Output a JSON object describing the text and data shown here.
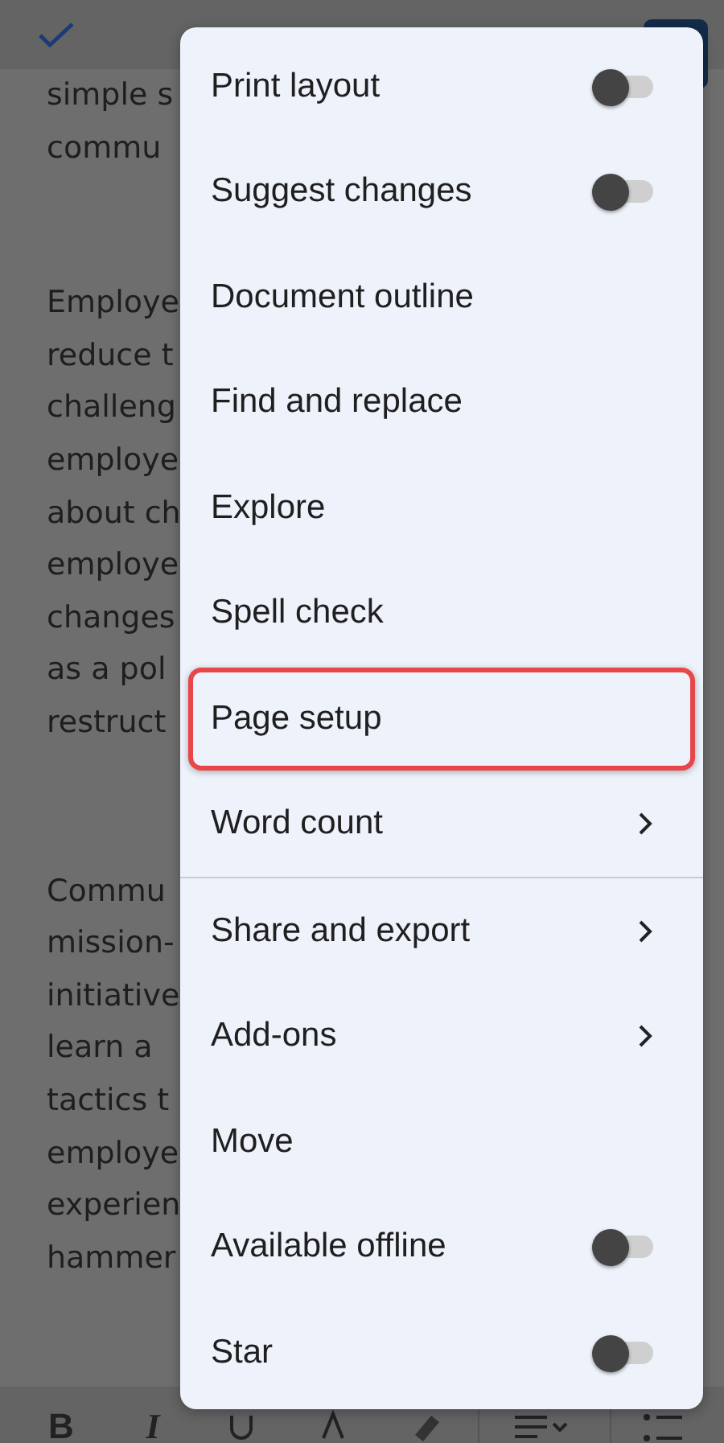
{
  "document": {
    "paragraphs": [
      {
        "lines": [
          "simple s",
          "commu"
        ]
      },
      {
        "lines": [
          "Employe",
          "reduce t",
          "challeng",
          "employe",
          "about ch",
          "employe",
          "changes",
          "as a pol",
          "restruct"
        ]
      },
      {
        "lines": [
          "Commu",
          "mission-",
          "initiative",
          "learn a",
          "tactics t",
          "employe",
          "experien",
          "hammer"
        ]
      }
    ]
  },
  "toolbar": {
    "bold": "B",
    "italic": "I"
  },
  "menu": {
    "sections": [
      {
        "items": [
          {
            "kind": "toggle",
            "label": "Print layout",
            "on": false,
            "highlighted": false
          },
          {
            "kind": "toggle",
            "label": "Suggest changes",
            "on": false,
            "highlighted": false
          },
          {
            "kind": "plain",
            "label": "Document outline",
            "highlighted": false
          },
          {
            "kind": "plain",
            "label": "Find and replace",
            "highlighted": false
          },
          {
            "kind": "plain",
            "label": "Explore",
            "highlighted": false
          },
          {
            "kind": "plain",
            "label": "Spell check",
            "highlighted": false
          },
          {
            "kind": "plain",
            "label": "Page setup",
            "highlighted": true
          },
          {
            "kind": "submenu",
            "label": "Word count",
            "highlighted": false
          }
        ]
      },
      {
        "items": [
          {
            "kind": "submenu",
            "label": "Share and export",
            "highlighted": false
          },
          {
            "kind": "submenu",
            "label": "Add-ons",
            "highlighted": false
          },
          {
            "kind": "plain",
            "label": "Move",
            "highlighted": false
          },
          {
            "kind": "toggle",
            "label": "Available offline",
            "on": false,
            "highlighted": false
          },
          {
            "kind": "toggle",
            "label": "Star",
            "on": false,
            "highlighted": false
          }
        ]
      }
    ]
  }
}
